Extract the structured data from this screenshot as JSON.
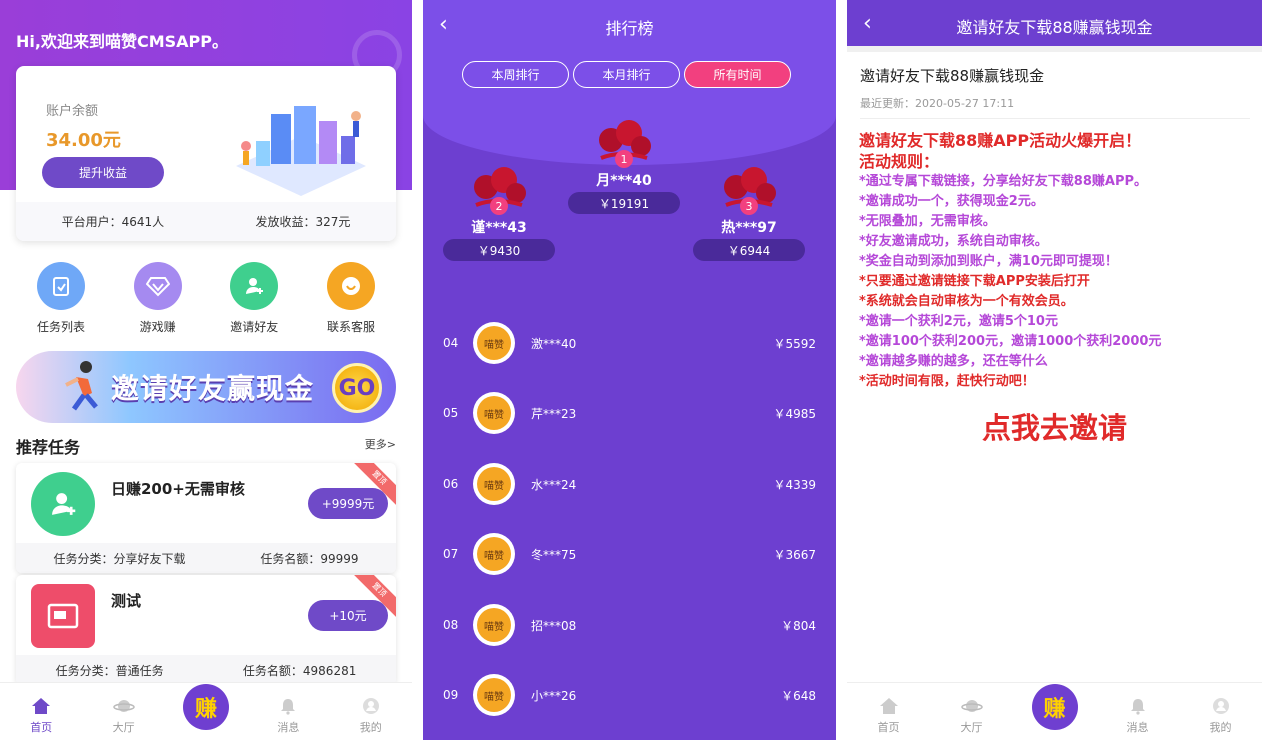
{
  "home": {
    "greeting": "Hi,欢迎来到喵赞CMSAPP。",
    "balance_label": "账户余额",
    "balance_value": "34.00元",
    "withdraw_button": "提升收益",
    "stats": {
      "users": "平台用户：4641人",
      "payout": "发放收益：327元"
    },
    "categories": [
      {
        "label": "任务列表",
        "icon": "clipboard-icon",
        "color": "#6fa8f7"
      },
      {
        "label": "游戏赚",
        "icon": "diamond-icon",
        "color": "#a58af0"
      },
      {
        "label": "邀请好友",
        "icon": "add-user-icon",
        "color": "#3fcf8e"
      },
      {
        "label": "联系客服",
        "icon": "chat-icon",
        "color": "#f5a623"
      }
    ],
    "banner_text": "邀请好友赢现金",
    "banner_go": "GO",
    "section_title": "推荐任务",
    "section_more": "更多>",
    "tasks": [
      {
        "title": "日赚200+无需审核",
        "reward": "+9999元",
        "category": "任务分类：分享好友下载",
        "quota": "任务名额：99999",
        "icon": "add-user-icon",
        "color": "#3fcf8e",
        "ribbon": "置顶"
      },
      {
        "title": "测试",
        "reward": "+10元",
        "category": "任务分类：普通任务",
        "quota": "任务名额：4986281",
        "icon": "image-icon",
        "color": "#ee4d6a",
        "ribbon": "置顶"
      }
    ]
  },
  "tabbar": {
    "home": "首页",
    "hall": "大厅",
    "earn": "赚",
    "messages": "消息",
    "mine": "我的"
  },
  "ranking": {
    "title": "排行榜",
    "tabs": [
      {
        "label": "本周排行",
        "active": false
      },
      {
        "label": "本月排行",
        "active": false
      },
      {
        "label": "所有时间",
        "active": true
      }
    ],
    "podium": [
      {
        "rank": "1",
        "name": "月***40",
        "amount": "￥19191"
      },
      {
        "rank": "2",
        "name": "谨***43",
        "amount": "￥9430"
      },
      {
        "rank": "3",
        "name": "热***97",
        "amount": "￥6944"
      }
    ],
    "list": [
      {
        "rank": "04",
        "name": "激***40",
        "amount": "￥5592",
        "avatar_text": "喵赞"
      },
      {
        "rank": "05",
        "name": "芹***23",
        "amount": "￥4985",
        "avatar_text": "喵赞"
      },
      {
        "rank": "06",
        "name": "水***24",
        "amount": "￥4339",
        "avatar_text": "喵赞"
      },
      {
        "rank": "07",
        "name": "冬***75",
        "amount": "￥3667",
        "avatar_text": "喵赞"
      },
      {
        "rank": "08",
        "name": "招***08",
        "amount": "￥804",
        "avatar_text": "喵赞"
      },
      {
        "rank": "09",
        "name": "小***26",
        "amount": "￥648",
        "avatar_text": "喵赞"
      }
    ]
  },
  "invite": {
    "header_title": "邀请好友下载88赚赢钱现金",
    "article_title": "邀请好友下载88赚赢钱现金",
    "updated": "最近更新：2020-05-27 17:11",
    "headline1": "邀请好友下载88赚APP活动火爆开启！",
    "headline2": "活动规则：",
    "rules": [
      {
        "text": "*通过专属下载链接，分享给好友下载88赚APP。",
        "color": "#b548d8"
      },
      {
        "text": "*邀请成功一个，获得现金2元。",
        "color": "#b548d8"
      },
      {
        "text": "*无限叠加，无需审核。",
        "color": "#b548d8"
      },
      {
        "text": "*好友邀请成功，系统自动审核。",
        "color": "#b548d8"
      },
      {
        "text": "*奖金自动到添加到账户，满10元即可提现！",
        "color": "#b548d8"
      },
      {
        "text": "*只要通过邀请链接下载APP安装后打开",
        "color": "#e02a2a"
      },
      {
        "text": "*系统就会自动审核为一个有效会员。",
        "color": "#e02a2a"
      },
      {
        "text": "*邀请一个获利2元，邀请5个10元",
        "color": "#b548d8"
      },
      {
        "text": "*邀请100个获利200元，邀请1000个获利2000元",
        "color": "#b548d8"
      },
      {
        "text": "*邀请越多赚的越多，还在等什么",
        "color": "#b548d8"
      },
      {
        "text": "*活动时间有限，赶快行动吧！",
        "color": "#e02a2a"
      }
    ],
    "cta": "点我去邀请"
  }
}
